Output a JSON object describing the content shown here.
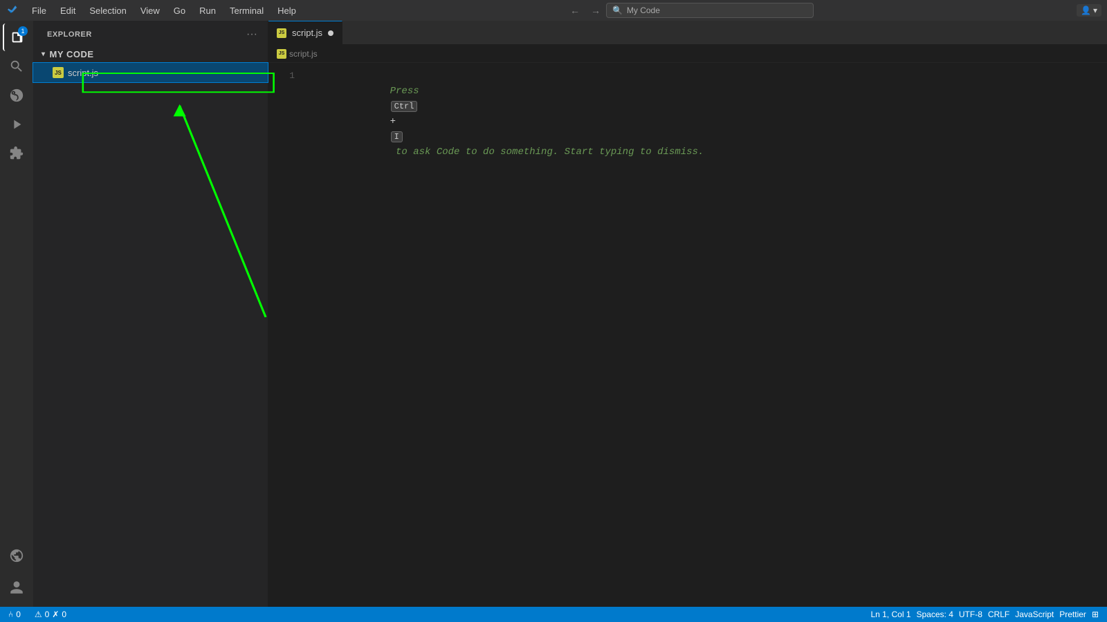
{
  "menubar": {
    "icon": "vscode-icon",
    "items": [
      "File",
      "Edit",
      "Selection",
      "View",
      "Go",
      "Run",
      "Terminal",
      "Help"
    ],
    "nav_back": "←",
    "nav_forward": "→",
    "search_placeholder": "My Code",
    "accounts_label": "⊕"
  },
  "activity_bar": {
    "items": [
      {
        "id": "explorer",
        "icon": "files-icon",
        "active": true,
        "badge": "1"
      },
      {
        "id": "search",
        "icon": "search-icon",
        "active": false
      },
      {
        "id": "source-control",
        "icon": "git-icon",
        "active": false
      },
      {
        "id": "run-debug",
        "icon": "debug-icon",
        "active": false
      },
      {
        "id": "extensions",
        "icon": "extensions-icon",
        "active": false
      }
    ],
    "bottom_items": [
      {
        "id": "remote",
        "icon": "remote-icon"
      },
      {
        "id": "accounts",
        "icon": "accounts-icon"
      }
    ]
  },
  "sidebar": {
    "title": "EXPLORER",
    "folder": {
      "name": "MY CODE",
      "expanded": true
    },
    "files": [
      {
        "name": "script.js",
        "type": "js",
        "selected": true
      }
    ]
  },
  "editor": {
    "tabs": [
      {
        "name": "script.js",
        "type": "js",
        "dirty": true,
        "active": true
      }
    ],
    "breadcrumb": [
      "script.js"
    ],
    "lines": [
      {
        "number": "1",
        "ghost": true,
        "text_press": "Press",
        "key1": "Ctrl",
        "plus": "+",
        "key2": "I",
        "text_after": " to ask Code to do something. Start typing to dismiss."
      }
    ]
  },
  "annotation": {
    "arrow_color": "#00ff00",
    "box_color": "#00ff00"
  },
  "status_bar": {
    "left_items": [
      "⑃ 0",
      "⚠ 0",
      "✗ 0"
    ],
    "right_items": [
      "Ln 1, Col 1",
      "Spaces: 4",
      "UTF-8",
      "CRLF",
      "JavaScript",
      "Prettier",
      "⊞"
    ]
  }
}
